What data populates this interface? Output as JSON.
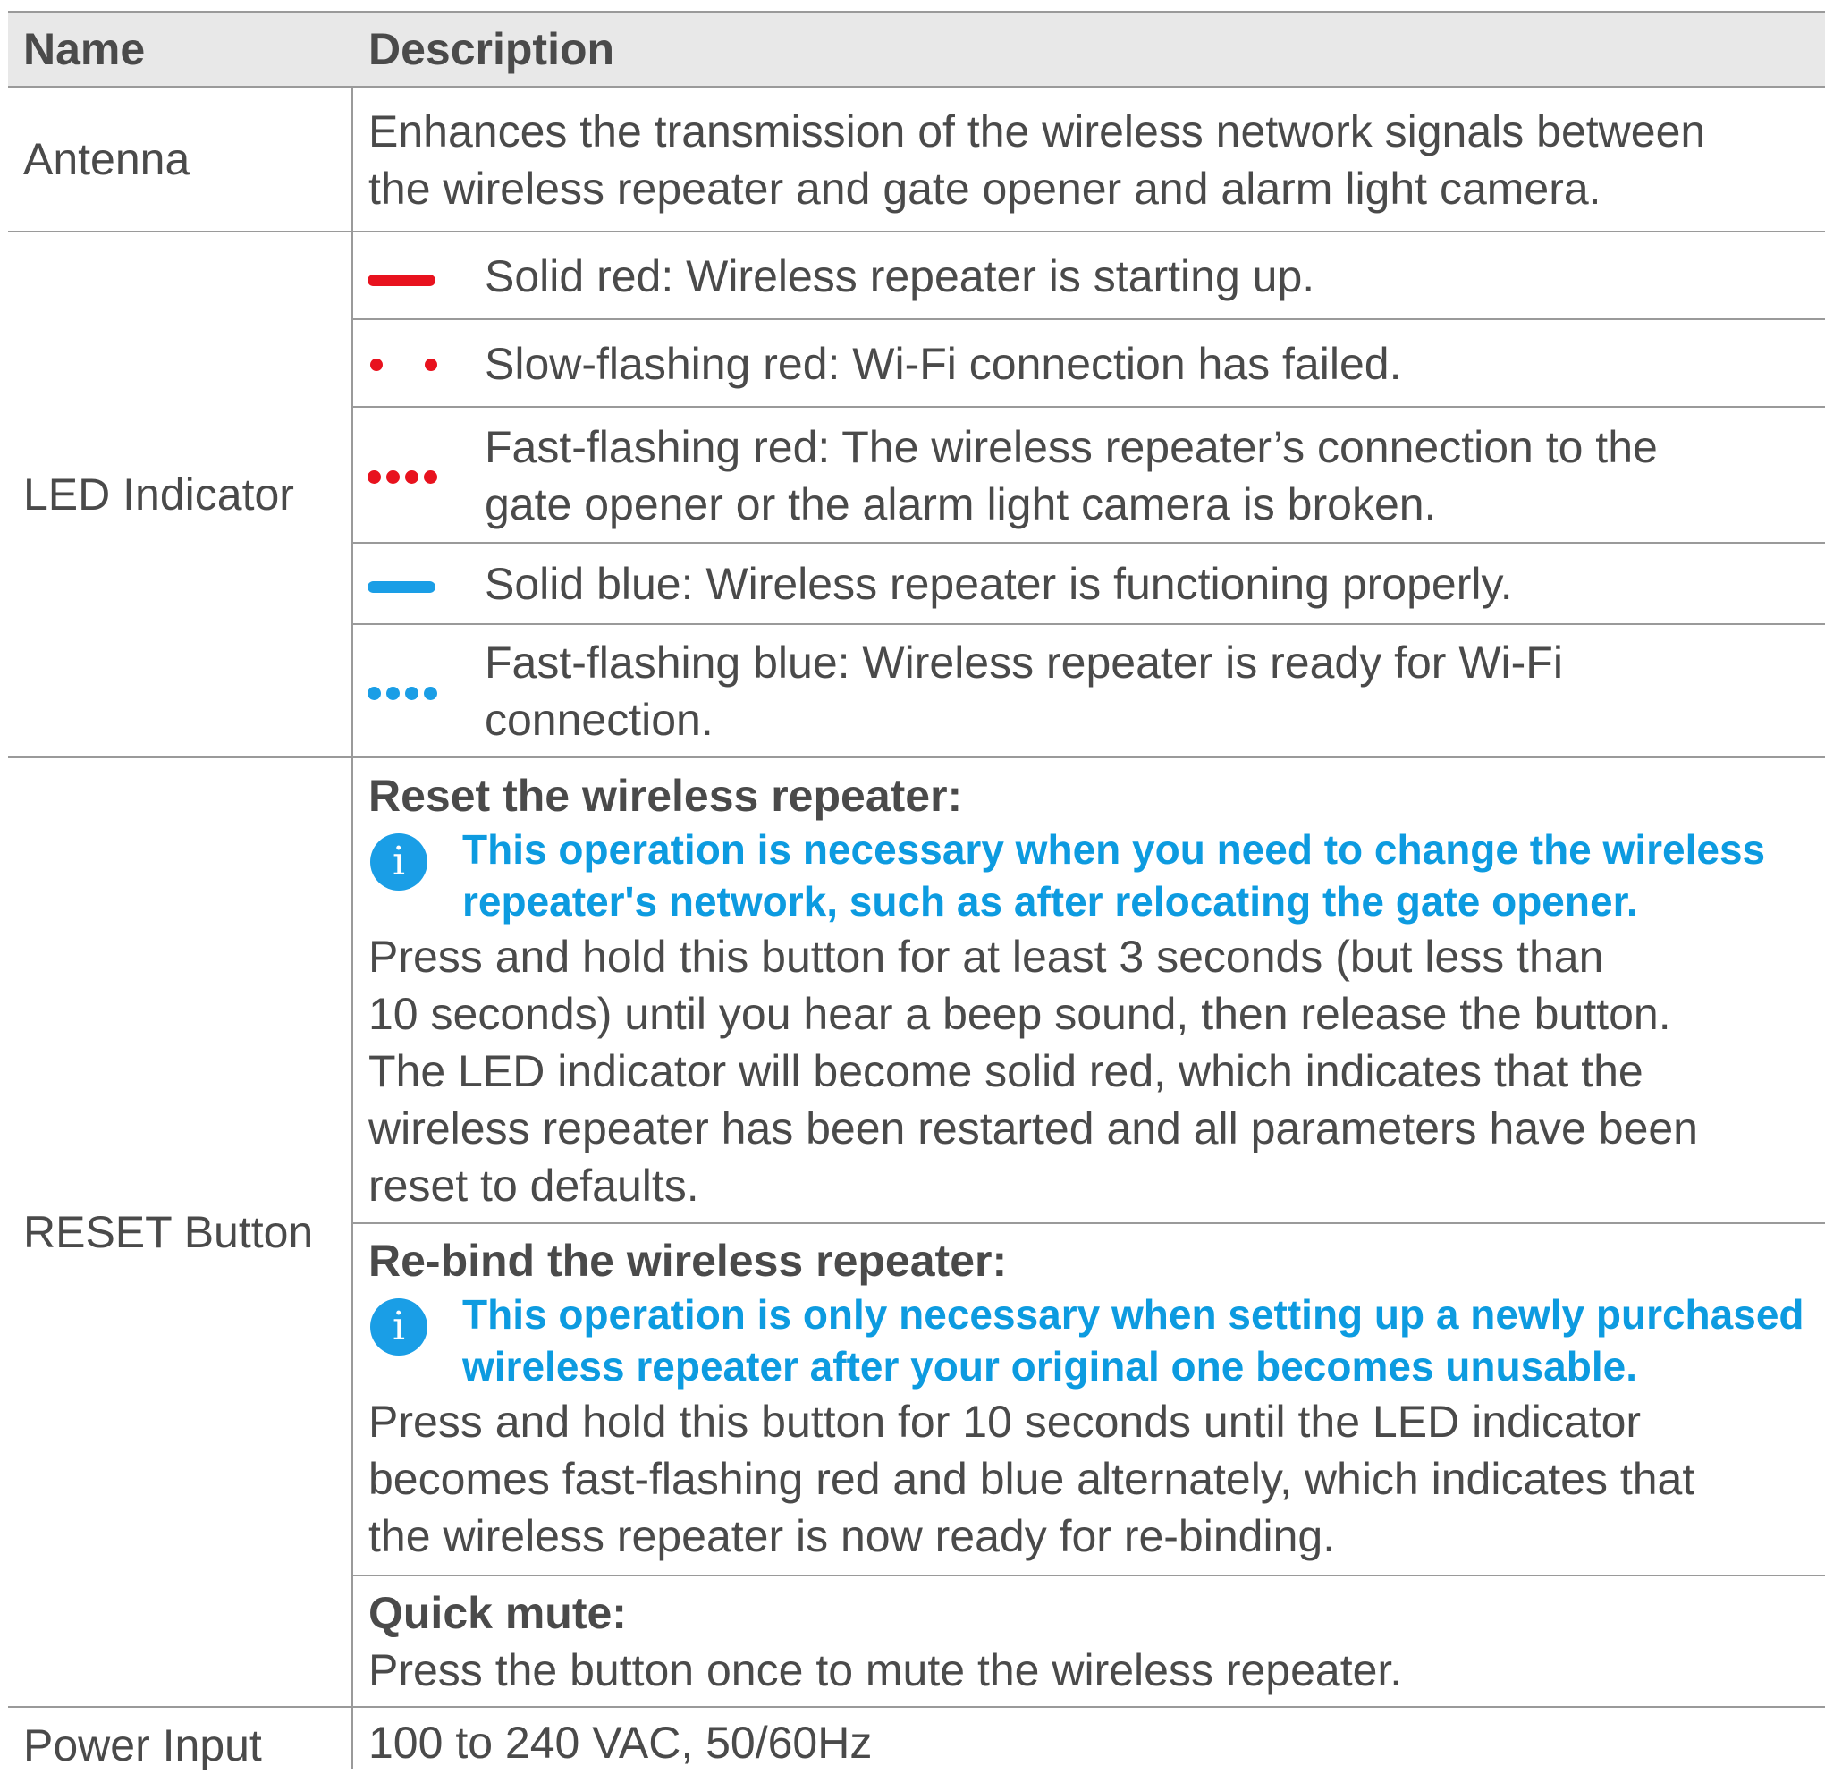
{
  "header": {
    "name": "Name",
    "description": "Description"
  },
  "rows": {
    "antenna": {
      "name": "Antenna",
      "line1": "Enhances the transmission of the wireless network signals between",
      "line2": "the wireless repeater and gate opener and alarm light camera."
    },
    "led": {
      "name": "LED Indicator",
      "states": [
        {
          "lines": [
            "Solid red: Wireless repeater is starting up."
          ],
          "color": "#e8121e",
          "icon": "solid-bar"
        },
        {
          "lines": [
            "Slow-flashing red: Wi-Fi connection has failed."
          ],
          "color": "#e8121e",
          "icon": "slow-dots"
        },
        {
          "lines": [
            "Fast-flashing red: The wireless repeater’s connection to the",
            "gate opener or the alarm light camera is broken."
          ],
          "color": "#e8121e",
          "icon": "fast-dots"
        },
        {
          "lines": [
            "Solid blue: Wireless repeater is functioning properly."
          ],
          "color": "#1a9ee6",
          "icon": "solid-bar"
        },
        {
          "lines": [
            "Fast-flashing blue: Wireless repeater is ready for Wi-Fi",
            "connection."
          ],
          "color": "#1a9ee6",
          "icon": "fast-dots"
        }
      ]
    },
    "reset": {
      "name": "RESET Button",
      "reset": {
        "title": "Reset the wireless repeater:",
        "note": [
          "This operation is necessary when you need to change the wireless",
          "repeater's network, such as after relocating the gate opener."
        ],
        "body": [
          "Press and hold this button for at least 3 seconds (but less than",
          "10 seconds) until you hear a beep sound, then release the button.",
          "The LED indicator will become solid red, which indicates that the",
          "wireless repeater has been restarted and all parameters have been",
          "reset to defaults."
        ]
      },
      "rebind": {
        "title": "Re-bind the wireless repeater:",
        "note": [
          "This operation is only necessary when setting up a newly purchased",
          "wireless repeater after your original one becomes unusable."
        ],
        "body": [
          "Press and hold this button for 10 seconds until the LED indicator",
          "becomes fast-flashing red and blue alternately, which indicates that",
          "the wireless repeater is now ready for re-binding."
        ]
      },
      "mute": {
        "title": "Quick mute:",
        "body": [
          "Press the button once to mute the wireless repeater."
        ]
      },
      "info_glyph": "i"
    },
    "power": {
      "name": "Power Input",
      "value": "100 to 240 VAC, 50/60Hz"
    }
  },
  "colors": {
    "led_red": "#e8121e",
    "led_blue": "#1a9ee6",
    "note_blue": "#0d9be0"
  }
}
